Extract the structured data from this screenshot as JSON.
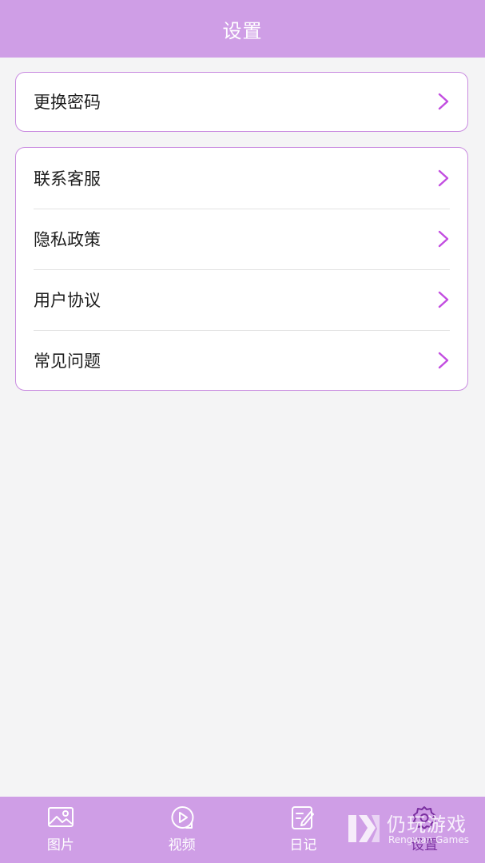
{
  "header": {
    "title": "设置"
  },
  "groups": [
    {
      "items": [
        {
          "label": "更换密码"
        }
      ]
    },
    {
      "items": [
        {
          "label": "联系客服"
        },
        {
          "label": "隐私政策"
        },
        {
          "label": "用户协议"
        },
        {
          "label": "常见问题"
        }
      ]
    }
  ],
  "tabbar": {
    "tabs": [
      {
        "label": "图片",
        "icon": "image-icon",
        "active": false
      },
      {
        "label": "视频",
        "icon": "play-circle-icon",
        "active": false
      },
      {
        "label": "日记",
        "icon": "notebook-edit-icon",
        "active": false
      },
      {
        "label": "设置",
        "icon": "gear-icon",
        "active": true
      }
    ]
  },
  "watermark": {
    "title": "仍玩游戏",
    "subtitle": "Rengwan Games"
  },
  "colors": {
    "header_bg": "#cf9ee6",
    "card_border": "#c98be0",
    "chevron": "#c24de0",
    "active_tab": "#7a2fa0",
    "page_bg": "#f4f4f5"
  }
}
